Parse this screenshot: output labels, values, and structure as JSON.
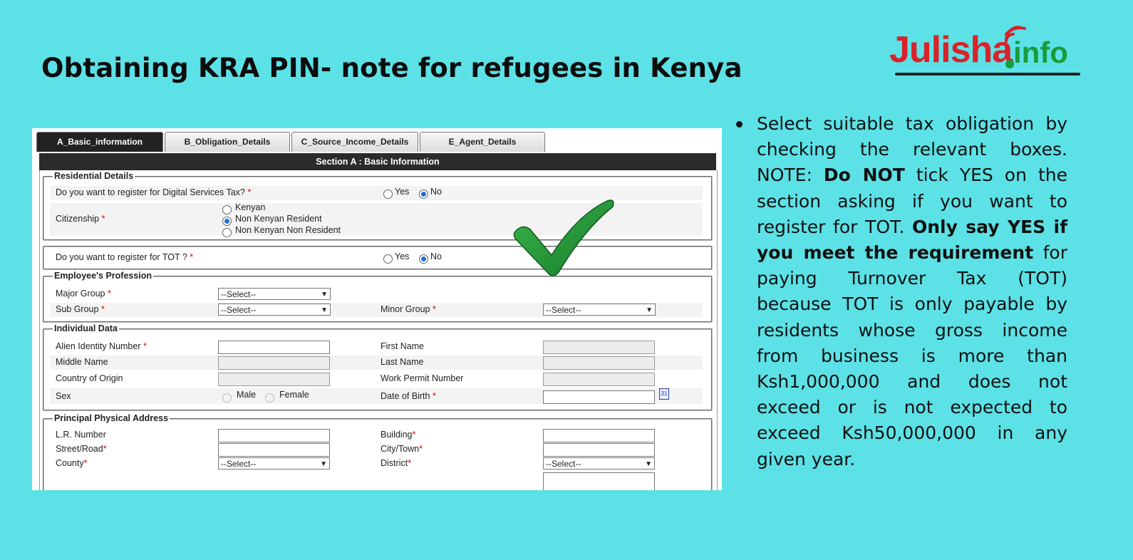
{
  "headline": "Obtaining KRA PIN- note for refugees in Kenya",
  "logo": {
    "name_part": "Julisha",
    "tld_part": "info",
    "brand_red": "#d8232a",
    "brand_green": "#1a9b3a"
  },
  "tabs": [
    {
      "label": "A_Basic_information",
      "active": true
    },
    {
      "label": "B_Obligation_Details",
      "active": false
    },
    {
      "label": "C_Source_Income_Details",
      "active": false
    },
    {
      "label": "E_Agent_Details",
      "active": false
    }
  ],
  "section_title": "Section A : Basic Information",
  "residential": {
    "legend": "Residential Details",
    "dst_question": "Do you want to register for Digital Services Tax?",
    "yes": "Yes",
    "no": "No",
    "citizenship_label": "Citizenship",
    "citizenship_options": [
      "Kenyan",
      "Non Kenyan Resident",
      "Non Kenyan Non Resident"
    ],
    "citizenship_selected": "Non Kenyan Resident"
  },
  "tot": {
    "question": "Do you want to register for TOT ?",
    "yes": "Yes",
    "no": "No"
  },
  "profession": {
    "legend": "Employee's Profession",
    "major_group": "Major Group",
    "sub_group": "Sub Group",
    "minor_group": "Minor Group",
    "select_placeholder": "--Select--"
  },
  "individual": {
    "legend": "Individual Data",
    "alien_id": "Alien Identity Number",
    "first_name": "First Name",
    "middle_name": "Middle Name",
    "last_name": "Last Name",
    "country_origin": "Country of Origin",
    "work_permit": "Work Permit Number",
    "sex": "Sex",
    "male": "Male",
    "female": "Female",
    "dob": "Date of Birth"
  },
  "address": {
    "legend": "Principal Physical Address",
    "lr_number": "L.R. Number",
    "building": "Building",
    "street": "Street/Road",
    "city": "City/Town",
    "county": "County",
    "district": "District",
    "select_placeholder": "--Select--"
  },
  "required_mark": "*",
  "note": {
    "p1": "Select suitable tax obligation by checking the relevant boxes. NOTE: ",
    "b1": "Do NOT",
    "p2": " tick YES on the section asking if you want to register for TOT. ",
    "b2": "Only say YES if you meet the requirement",
    "p3": " for paying Turnover Tax (TOT) because TOT is only payable by residents whose gross income from business is more than Ksh1,000,000 and does not exceed or is not expected to exceed Ksh50,000,000 in any given year."
  },
  "icons": {
    "check": "checkmark-icon",
    "calendar": "calendar-icon",
    "dropdown": "chevron-down-icon"
  }
}
